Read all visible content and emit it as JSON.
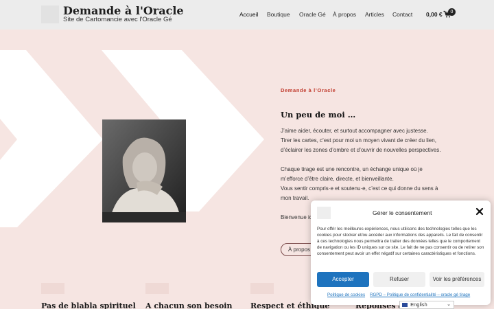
{
  "header": {
    "site_title": "Demande à l'Oracle",
    "tagline": "Site de Cartomancie avec l'Oracle Gé",
    "nav": [
      {
        "label": "Accueil"
      },
      {
        "label": "Boutique"
      },
      {
        "label": "Oracle Gé"
      },
      {
        "label": "À propos"
      },
      {
        "label": "Articles"
      },
      {
        "label": "Contact"
      }
    ],
    "cart_total": "0,00 €",
    "cart_count": "0"
  },
  "about": {
    "eyebrow": "Demande à l’Oracle",
    "title": "Un peu de moi …",
    "lines": [
      "J’aime aider, écouter, et surtout accompagner avec justesse.",
      "Tirer les cartes, c’est pour moi un moyen vivant de créer du lien,",
      "d’éclairer les zones d’ombre et d’ouvrir de nouvelles perspectives.",
      "Chaque tirage est une rencontre, un échange unique où je",
      "m’efforce d’être claire, directe, et bienveillante.",
      "Vous sentir compris·e et soutenu·e, c’est ce qui donne du sens à",
      "mon travail.",
      "Bienvenue ici"
    ],
    "button_label": "À propos"
  },
  "features": [
    {
      "title": "Pas de blabla spirituel"
    },
    {
      "title": "A chacun son besoin"
    },
    {
      "title": "Respect et éthique"
    },
    {
      "title": "Réponses accessibles"
    }
  ],
  "consent": {
    "title": "Gérer le consentement",
    "text": "Pour offrir les meilleures expériences, nous utilisons des technologies telles que les cookies pour stocker et/ou accéder aux informations des appareils. Le fait de consentir à ces technologies nous permettra de traiter des données telles que le comportement de navigation ou les ID uniques sur ce site. Le fait de ne pas consentir ou de retirer son consentement peut avoir un effet négatif sur certaines caractéristiques et fonctions.",
    "accept_label": "Accepter",
    "refuse_label": "Refuser",
    "prefs_label": "Voir les préférences",
    "cookie_policy_link": "Politique de cookies",
    "privacy_link": "RGPD – Politique de confidentialité – oracle gé tirage"
  },
  "language": {
    "selected": "English"
  },
  "colors": {
    "background": "#f6e5e2",
    "header": "#ececec",
    "accent_red": "#c0392b",
    "accept_blue": "#1e73be"
  }
}
